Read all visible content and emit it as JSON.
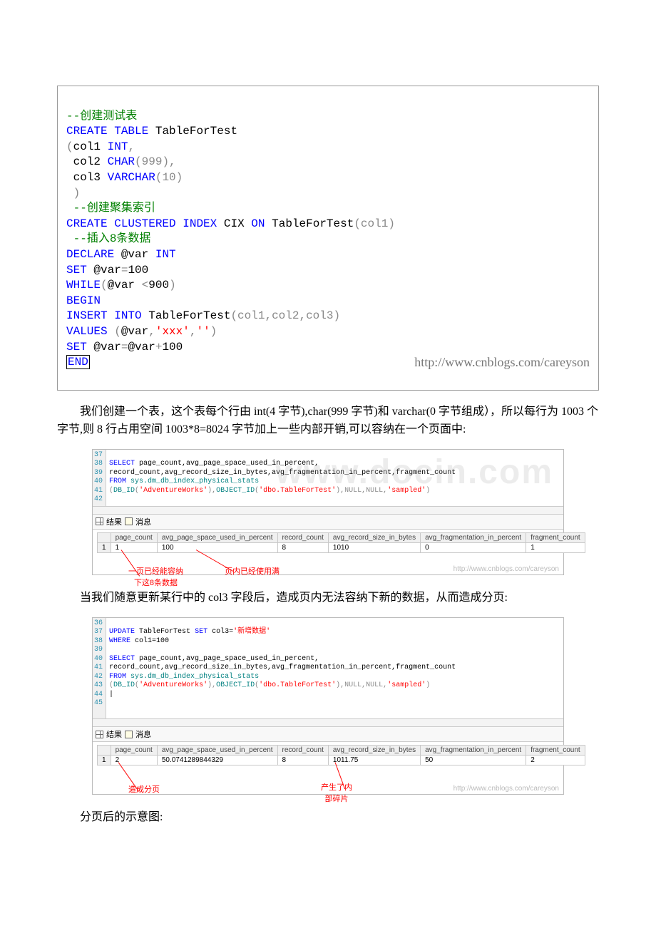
{
  "code1": {
    "l1": "--创建测试表",
    "l2a": "CREATE",
    "l2b": "TABLE",
    "l2c": "TableForTest",
    "l3a": "(",
    "l3b": "col1",
    "l3c": "INT",
    "l3d": ",",
    "l4a": "col2",
    "l4b": "CHAR",
    "l4c": "(999),",
    "l5a": "col3",
    "l5b": "VARCHAR",
    "l5c": "(10)",
    "l6": ")",
    "l7": "--创建聚集索引",
    "l8a": "CREATE",
    "l8b": "CLUSTERED",
    "l8c": "INDEX",
    "l8d": "CIX",
    "l8e": "ON",
    "l8f": "TableForTest",
    "l8g": "(col1)",
    "l9": "--插入8条数据",
    "l10a": "DECLARE",
    "l10b": "@var",
    "l10c": "INT",
    "l11a": "SET",
    "l11b": "@var",
    "l11c": "=",
    "l11d": "100",
    "l12a": "WHILE",
    "l12b": "(",
    "l12c": "@var",
    "l12d": "<",
    "l12e": "900",
    "l12f": ")",
    "l13": "BEGIN",
    "l14a": "INSERT",
    "l14b": "INTO",
    "l14c": "TableForTest",
    "l14d": "(col1,col2,col3)",
    "l15a": "VALUES",
    "l15b": "(",
    "l15c": "@var",
    "l15d": ",",
    "l15e": "'xxx'",
    "l15f": ",",
    "l15g": "''",
    "l15h": ")",
    "l16a": "SET",
    "l16b": "@var",
    "l16c": "=",
    "l16d": "@var",
    "l16e": "+",
    "l16f": "100",
    "l17": "END",
    "watermark": "http://www.cnblogs.com/careyson"
  },
  "para1": "我们创建一个表，这个表每个行由 int(4 字节),char(999 字节)和 varchar(0 字节组成），所以每行为 1003 个字节,则 8 行占用空间 1003*8=8024 字节加上一些内部开销,可以容纳在一个页面中:",
  "ssms1": {
    "gutter": [
      "37",
      "38",
      "39",
      "40",
      "41",
      "42"
    ],
    "code": {
      "l38a": "SELECT",
      "l38b": "page_count,avg_page_space_used_in_percent,",
      "l39": "record_count,avg_record_size_in_bytes,avg_fragmentation_in_percent,fragment_count",
      "l40a": "FROM",
      "l40b": "sys.dm_db_index_physical_stats",
      "l41a": "(",
      "l41b": "DB_ID",
      "l41c": "(",
      "l41d": "'AdventureWorks'",
      "l41e": "),",
      "l41f": "OBJECT_ID",
      "l41g": "(",
      "l41h": "'dbo.TableForTest'",
      "l41i": "),",
      "l41j": "NULL,NULL,",
      "l41k": "'sampled'",
      "l41l": ")"
    },
    "tabs": {
      "results": "结果",
      "messages": "消息"
    },
    "headers": [
      "",
      "page_count",
      "avg_page_space_used_in_percent",
      "record_count",
      "avg_record_size_in_bytes",
      "avg_fragmentation_in_percent",
      "fragment_count"
    ],
    "row": [
      "1",
      "1",
      "100",
      "8",
      "1010",
      "0",
      "1"
    ],
    "annot1": "一页已经能容纳\n下这8条数据",
    "annot2": "页内已经使用满",
    "wm": "http://www.cnblogs.com/careyson",
    "bigwm": "www.docin.com"
  },
  "para2": "当我们随意更新某行中的 col3 字段后，造成页内无法容纳下新的数据，从而造成分页:",
  "ssms2": {
    "gutter": [
      "36",
      "37",
      "38",
      "39",
      "40",
      "41",
      "42",
      "43",
      "44",
      "45"
    ],
    "code": {
      "l36a": "UPDATE",
      "l36b": "TableForTest",
      "l36c": "SET",
      "l36d": "col3=",
      "l36e": "'新增数据'",
      "l37a": "WHERE",
      "l37b": "col1=100",
      "l39a": "SELECT",
      "l39b": "page_count,avg_page_space_used_in_percent,",
      "l40": "record_count,avg_record_size_in_bytes,avg_fragmentation_in_percent,fragment_count",
      "l41a": "FROM",
      "l41b": "sys.dm_db_index_physical_stats",
      "l42a": "(",
      "l42b": "DB_ID",
      "l42c": "(",
      "l42d": "'AdventureWorks'",
      "l42e": "),",
      "l42f": "OBJECT_ID",
      "l42g": "(",
      "l42h": "'dbo.TableForTest'",
      "l42i": "),",
      "l42j": "NULL,NULL,",
      "l42k": "'sampled'",
      "l42l": ")"
    },
    "tabs": {
      "results": "结果",
      "messages": "消息"
    },
    "headers": [
      "",
      "page_count",
      "avg_page_space_used_in_percent",
      "record_count",
      "avg_record_size_in_bytes",
      "avg_fragmentation_in_percent",
      "fragment_count"
    ],
    "row": [
      "1",
      "2",
      "50.0741289844329",
      "8",
      "1011.75",
      "50",
      "2"
    ],
    "annot1": "造成分页",
    "annot2": "产生了内\n部碎片",
    "wm": "http://www.cnblogs.com/careyson"
  },
  "para3": "分页后的示意图:"
}
